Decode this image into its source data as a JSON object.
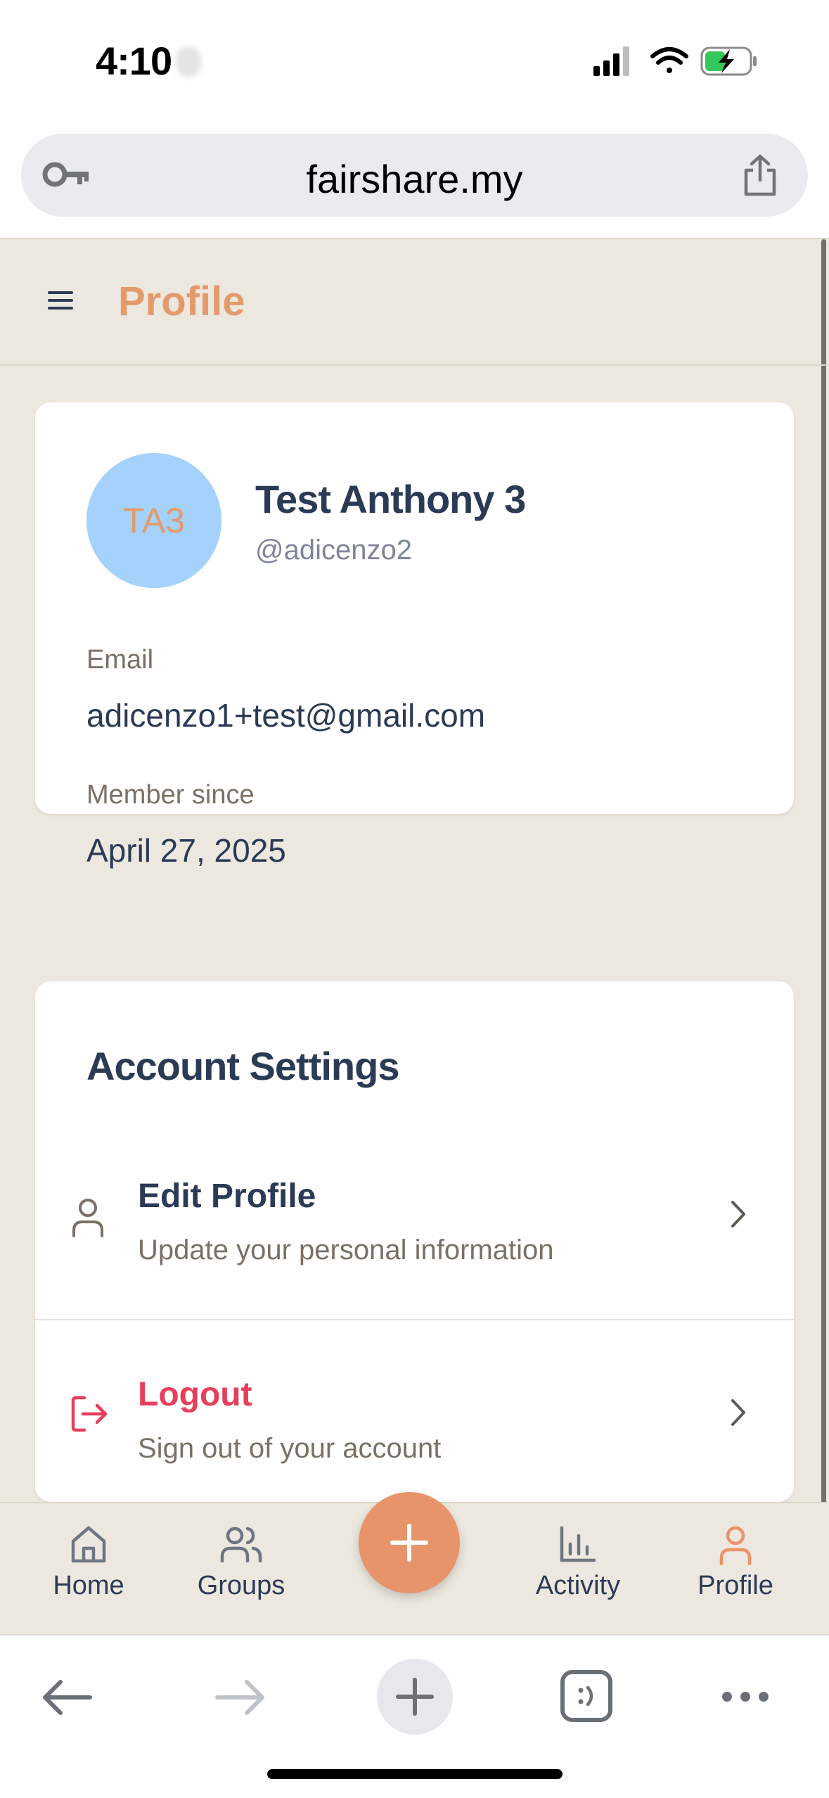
{
  "status_bar": {
    "time": "4:10"
  },
  "browser": {
    "url": "fairshare.my"
  },
  "header": {
    "title": "Profile"
  },
  "profile": {
    "avatar_initials": "TA3",
    "name": "Test Anthony 3",
    "handle": "@adicenzo2",
    "email_label": "Email",
    "email_value": "adicenzo1+test@gmail.com",
    "member_label": "Member since",
    "member_value": "April 27, 2025"
  },
  "account_settings": {
    "title": "Account Settings",
    "items": [
      {
        "title": "Edit Profile",
        "subtitle": "Update your personal information"
      },
      {
        "title": "Logout",
        "subtitle": "Sign out of your account"
      }
    ]
  },
  "bottom_nav": {
    "items": [
      {
        "label": "Home",
        "icon": "home-icon"
      },
      {
        "label": "Groups",
        "icon": "users-icon"
      },
      {
        "label": "Activity",
        "icon": "bar-chart-icon"
      },
      {
        "label": "Profile",
        "icon": "user-icon",
        "active": true
      }
    ],
    "fab_icon": "plus-icon"
  },
  "colors": {
    "accent": "#e8946a",
    "title_accent": "#e49a6b",
    "danger": "#e63f5b",
    "text_dark": "#2b3a55",
    "page_bg": "#ede8df",
    "avatar_bg": "#a4d2fb"
  }
}
